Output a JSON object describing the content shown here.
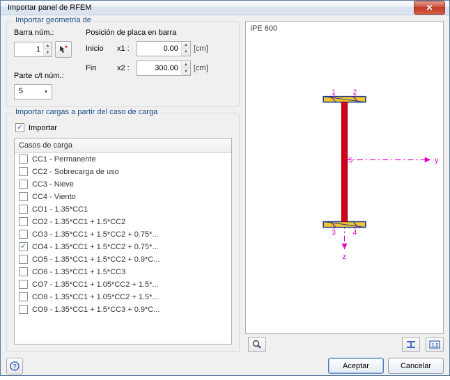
{
  "window": {
    "title": "Importar panel de RFEM"
  },
  "geometry_group": {
    "title": "Importar geometría de",
    "member_label": "Barra núm.:",
    "member_value": "1",
    "plate_pos_label": "Posición de placa en barra",
    "start_label": "Inicio",
    "start_var": "x1 :",
    "start_value": "0.00",
    "end_label": "Fin",
    "end_var": "x2 :",
    "end_value": "300.00",
    "unit": "[cm]",
    "part_label": "Parte c/t núm.:",
    "part_value": "5"
  },
  "loadcase_group": {
    "title": "Importar cargas a partir del caso de carga",
    "import_checkbox_label": "Importar",
    "import_checked": true,
    "list_header": "Casos de carga",
    "items": [
      {
        "checked": false,
        "label": "CC1 - Permanente"
      },
      {
        "checked": false,
        "label": "CC2 - Sobrecarga de uso"
      },
      {
        "checked": false,
        "label": "CC3 - Nieve"
      },
      {
        "checked": false,
        "label": "CC4 - Viento"
      },
      {
        "checked": false,
        "label": "CO1 - 1.35*CC1"
      },
      {
        "checked": false,
        "label": "CO2 - 1.35*CC1 + 1.5*CC2"
      },
      {
        "checked": false,
        "label": "CO3 - 1.35*CC1 + 1.5*CC2 + 0.75*..."
      },
      {
        "checked": true,
        "label": "CO4 - 1.35*CC1 + 1.5*CC2 + 0.75*..."
      },
      {
        "checked": false,
        "label": "CO5 - 1.35*CC1 + 1.5*CC2 + 0.9*C..."
      },
      {
        "checked": false,
        "label": "CO6 - 1.35*CC1 + 1.5*CC3"
      },
      {
        "checked": false,
        "label": "CO7 - 1.35*CC1 + 1.05*CC2 + 1.5*..."
      },
      {
        "checked": false,
        "label": "CO8 - 1.35*CC1 + 1.05*CC2 + 1.5*..."
      },
      {
        "checked": false,
        "label": "CO9 - 1.35*CC1 + 1.5*CC3 + 0.9*C..."
      }
    ]
  },
  "preview": {
    "section_title": "IPE 600",
    "nodes": {
      "tl": "1",
      "tr": "2",
      "bl": "3",
      "br": "4",
      "mid": "5"
    },
    "axes": {
      "y": "y",
      "z": "z"
    }
  },
  "buttons": {
    "accept": "Aceptar",
    "cancel": "Cancelar"
  }
}
